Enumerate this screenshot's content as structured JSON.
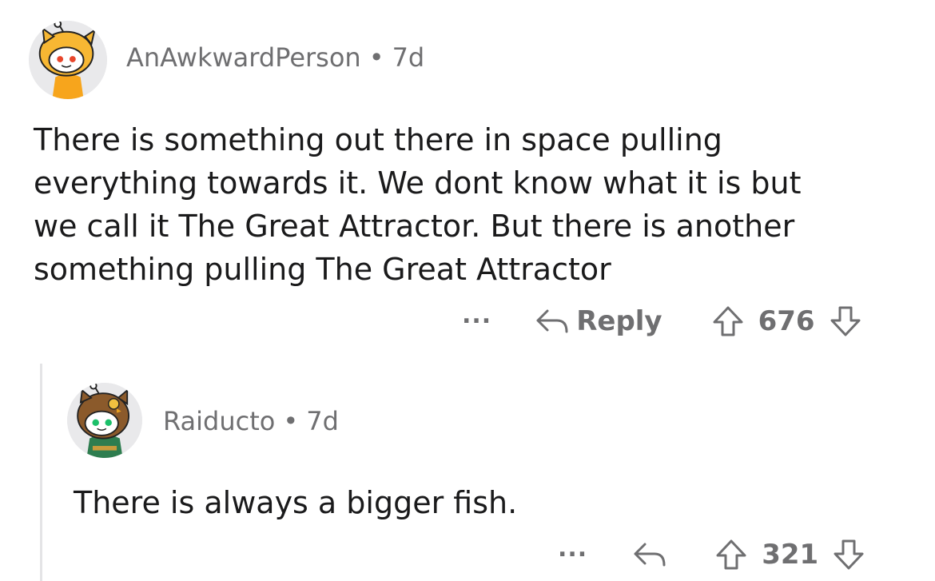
{
  "comments": [
    {
      "username": "AnAwkwardPerson",
      "separator": "•",
      "age": "7d",
      "avatar_icon": "snoo-avatar-shiba-hood-icon",
      "body_lines": [
        "There is something out there in space pulling",
        "everything towards it. We dont know what it is but",
        "we call it The Great Attractor. But there is another",
        "something pulling The Great Attractor"
      ],
      "more_label": "...",
      "reply_label": "Reply",
      "vote_count": "676"
    },
    {
      "username": "Raiducto",
      "separator": "•",
      "age": "7d",
      "avatar_icon": "snoo-avatar-owl-hood-icon",
      "body_lines": [
        "There is always a bigger fish."
      ],
      "more_label": "...",
      "vote_count": "321"
    }
  ],
  "colors": {
    "text": "#1a1a1b",
    "meta": "#6f6f71",
    "thread_line": "#e4e4e6",
    "avatar_bg": "#e9e9eb"
  }
}
